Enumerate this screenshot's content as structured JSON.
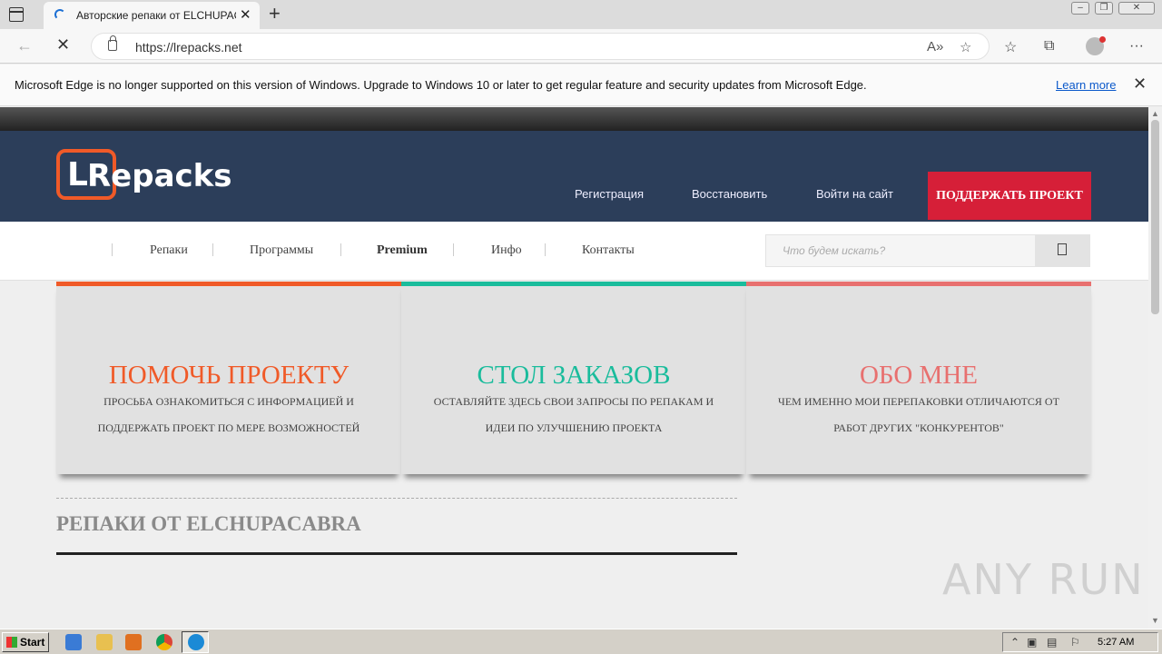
{
  "browser": {
    "tab_title": "Авторские репаки от ELCHUPACABRA",
    "tab_close": "✕",
    "new_tab": "+",
    "url": "https://lrepacks.net",
    "infobar_text": "Microsoft Edge is no longer supported on this version of Windows. Upgrade to Windows 10 or later to get regular feature and security updates from Microsoft Edge.",
    "infobar_link": "Learn more",
    "infobar_close": "✕"
  },
  "site": {
    "logo_letter": "L",
    "logo_text": "Repacks",
    "header_links": [
      "Регистрация",
      "Восстановить",
      "Войти на сайт"
    ],
    "support_button": "ПОДДЕРЖАТЬ ПРОЕКТ",
    "nav": [
      "Репаки",
      "Программы",
      "Premium",
      "Инфо",
      "Контакты"
    ],
    "search_placeholder": "Что будем искать?",
    "cards": [
      {
        "title": "ПОМОЧЬ ПРОЕКТУ",
        "desc": "ПРОСЬБА ОЗНАКОМИТЬСЯ С ИНФОРМАЦИЕЙ И ПОДДЕРЖАТЬ ПРОЕКТ ПО МЕРЕ ВОЗМОЖНОСТЕЙ",
        "color": "#f05a28"
      },
      {
        "title": "СТОЛ ЗАКАЗОВ",
        "desc": "ОСТАВЛЯЙТЕ ЗДЕСЬ СВОИ ЗАПРОСЫ ПО РЕПАКАМ И ИДЕИ ПО УЛУЧШЕНИЮ ПРОЕКТА",
        "color": "#1abc9c"
      },
      {
        "title": "ОБО МНЕ",
        "desc": "ЧЕМ ИМЕННО МОИ ПЕРЕПАКОВКИ ОТЛИЧАЮТСЯ ОТ РАБОТ ДРУГИХ \"КОНКУРЕНТОВ\"",
        "color": "#e8706f"
      }
    ],
    "section_title": "РЕПАКИ ОТ ELCHUPACABRA"
  },
  "watermark": "ANY RUN",
  "taskbar": {
    "start": "Start",
    "clock": "5:27 AM"
  }
}
